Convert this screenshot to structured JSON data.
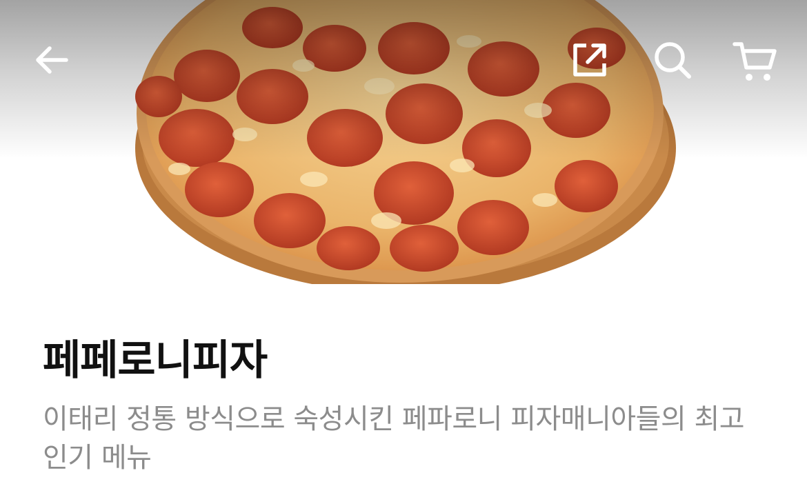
{
  "header": {
    "back_icon": "arrow-left-icon",
    "share_icon": "share-external-icon",
    "search_icon": "search-icon",
    "cart_icon": "cart-icon"
  },
  "product": {
    "image_alt": "pepperoni pizza on wooden board",
    "name": "페페로니피자",
    "description": "이태리 정통 방식으로 숙성시킨 페파로니 피자매니아들의 최고 인기 메뉴"
  },
  "colors": {
    "title": "#111111",
    "description": "#8c8c8c",
    "icon": "#ffffff",
    "cheese": "#f0c27a",
    "pepperoni": "#c9452a",
    "board": "#b9793c"
  }
}
